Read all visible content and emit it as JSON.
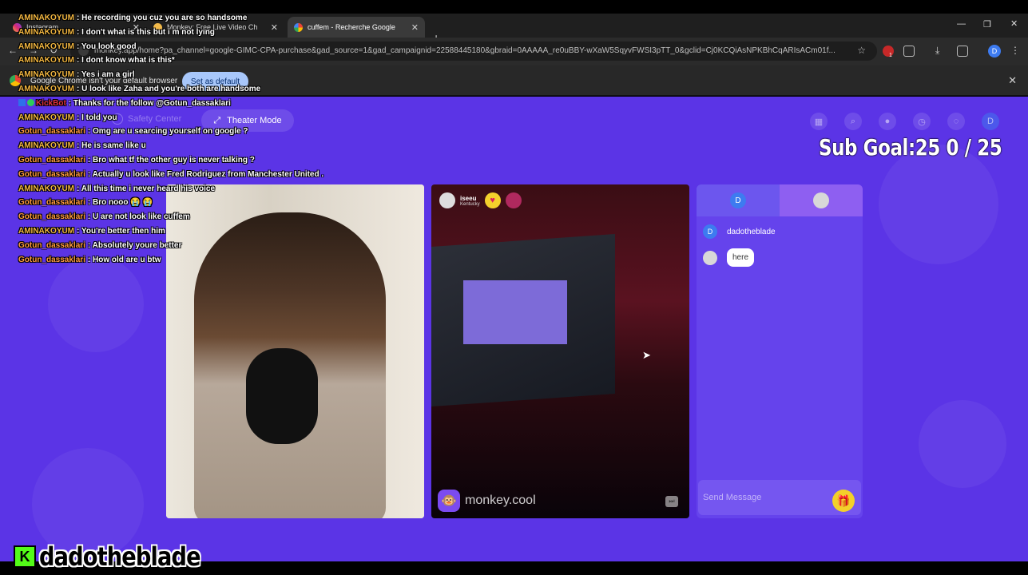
{
  "browser": {
    "tabs": [
      {
        "label": "Instagram",
        "icon": "instagram-icon"
      },
      {
        "label": "Monkey: Free Live Video Ch",
        "icon": "monkey-icon"
      },
      {
        "label": "cuffem - Recherche Google",
        "icon": "google-icon"
      }
    ],
    "new_tab": "+",
    "url": "monkey.app/home?pa_channel=google-GIMC-CPA-purchase&gad_source=1&gad_campaignid=22588445180&gbraid=0AAAAA_re0uBBY-wXaW5SqyvFWSI3pTT_0&gclid=Cj0KCQiAsNPKBhCqARIsACm01f...",
    "profile_initial": "D",
    "extension_badge": "1",
    "infobar": {
      "text": "Google Chrome isn't your default browser",
      "button": "Set as default"
    }
  },
  "site": {
    "safety_center": "Safety Center",
    "theater_mode": "Theater Mode",
    "header_avatar_initial": "D",
    "remote": {
      "name": "iseeu",
      "location": "Kentucky",
      "watermark": "monkey.cool"
    },
    "chat": {
      "me_initial": "D",
      "messages": [
        {
          "author": "dadotheblade",
          "text": "dadotheblade"
        },
        {
          "text": "here"
        }
      ],
      "placeholder": "Send Message"
    }
  },
  "stream_overlay": {
    "sub_goal": "Sub Goal:25  0 / 25",
    "streamer": "dadotheblade",
    "platform_logo": "K",
    "chat_lines": [
      {
        "user": "AMINAKOYUM",
        "text": ": He recording you cuz you are so handsome",
        "cls": "u-amina"
      },
      {
        "user": "AMINAKOYUM",
        "text": ": I don't what is this but i m not lying",
        "cls": "u-amina"
      },
      {
        "user": "AMINAKOYUM",
        "text": ": You look good",
        "cls": "u-amina"
      },
      {
        "user": "AMINAKOYUM",
        "text": ": I dont know what is this*",
        "cls": "u-amina"
      },
      {
        "user": "AMINAKOYUM",
        "text": ": Yes i am a girl",
        "cls": "u-amina"
      },
      {
        "user": "AMINAKOYUM",
        "text": ": U look like Zaha and you're both are handsome",
        "cls": "u-amina"
      },
      {
        "user": "KickBot",
        "text": ": Thanks for the follow @Gotun_dassaklari",
        "cls": "u-red",
        "badges": true
      },
      {
        "user": "AMINAKOYUM",
        "text": ": I told you",
        "cls": "u-amina"
      },
      {
        "user": "Gotun_dassaklari",
        "text": ": Omg are u searcing yourself on google ?",
        "cls": "u-gotun"
      },
      {
        "user": "AMINAKOYUM",
        "text": ": He is same like u",
        "cls": "u-amina"
      },
      {
        "user": "Gotun_dassaklari",
        "text": ": Bro what tf the other guy is never talking ?",
        "cls": "u-gotun"
      },
      {
        "user": "Gotun_dassaklari",
        "text": ": Actually u look like Fred Rodriguez from Manchester United .",
        "cls": "u-gotun"
      },
      {
        "user": "AMINAKOYUM",
        "text": ": All this time i never heard his voice",
        "cls": "u-amina"
      },
      {
        "user": "Gotun_dassaklari",
        "text": ": Bro nooo 😭 😭",
        "cls": "u-gotun"
      },
      {
        "user": "Gotun_dassaklari",
        "text": ": U are not look like cuffem",
        "cls": "u-gotun"
      },
      {
        "user": "AMINAKOYUM",
        "text": ": You're better then him",
        "cls": "u-amina"
      },
      {
        "user": "Gotun_dassaklari",
        "text": ": Absolutely youre better",
        "cls": "u-gotun"
      },
      {
        "user": "Gotun_dassaklari",
        "text": ": How old are u btw",
        "cls": "u-gotun"
      }
    ]
  }
}
